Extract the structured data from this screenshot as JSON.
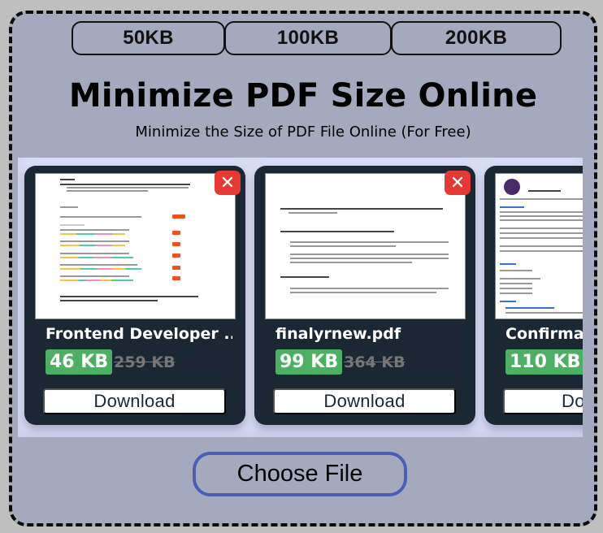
{
  "size_presets": [
    {
      "label": "50KB"
    },
    {
      "label": "100KB"
    },
    {
      "label": "200KB"
    }
  ],
  "header": {
    "title": "Minimize PDF Size Online",
    "subtitle": "Minimize the Size of PDF File Online (For Free)"
  },
  "files": [
    {
      "name": "Frontend Developer ...",
      "compressed_size": "46 KB",
      "original_size": "259 KB",
      "download_label": "Download",
      "remove_icon": "close-icon"
    },
    {
      "name": "finalyrnew.pdf",
      "compressed_size": "99 KB",
      "original_size": "364 KB",
      "download_label": "Download",
      "remove_icon": "close-icon"
    },
    {
      "name": "Confirma",
      "compressed_size": "110 KB",
      "original_size": "",
      "download_label": "Dov",
      "remove_icon": "close-icon"
    }
  ],
  "choose_file": {
    "label": "Choose File"
  },
  "colors": {
    "page_bg": "#bfbfbf",
    "panel_bg": "#a5a9bd",
    "scroller_bg": "#d9dcf5",
    "card_bg": "#1b2733",
    "compressed_badge": "#4caf63",
    "remove_button": "#e53935",
    "choose_border": "#4a5fb4"
  }
}
